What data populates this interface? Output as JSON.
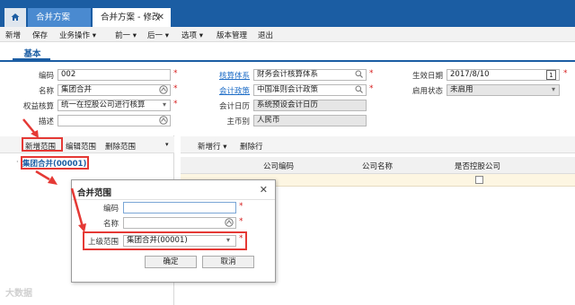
{
  "tabs": {
    "home_icon": "home-icon",
    "inactive_label": "合并方案",
    "active_label": "合并方案 - 修改",
    "close_glyph": "✕"
  },
  "menu": {
    "new": "新增",
    "save": "保存",
    "business_ops": "业务操作",
    "prev": "前一",
    "next": "后一",
    "options": "选项",
    "version_mgmt": "版本管理",
    "exit": "退出",
    "dropdown_glyph": "▾"
  },
  "section": {
    "basic": "基本"
  },
  "form": {
    "code_label": "编码",
    "code_value": "002",
    "name_label": "名称",
    "name_value": "集团合并",
    "equity_label": "权益核算",
    "equity_value": "统一在控股公司进行核算",
    "desc_label": "描述",
    "desc_value": "",
    "acct_system_label": "核算体系",
    "acct_system_value": "财务会计核算体系",
    "acct_policy_label": "会计政策",
    "acct_policy_value": "中国准则会计政策",
    "acct_calendar_label": "会计日历",
    "acct_calendar_value": "系统预设会计日历",
    "currency_label": "主币别",
    "currency_value": "人民币",
    "eff_date_label": "生效日期",
    "eff_date_value": "2017/8/10",
    "status_label": "启用状态",
    "status_value": "未启用",
    "calendar_day": "1",
    "required_mark": "*"
  },
  "left_toolbar": {
    "add_scope": "新增范围",
    "edit_scope": "编辑范围",
    "delete_scope": "删除范围"
  },
  "tree": {
    "root": "集团合并(00001)",
    "bullet": "·"
  },
  "right_toolbar": {
    "add_row": "新增行",
    "delete_row": "删除行"
  },
  "grid": {
    "col_code": "公司编码",
    "col_name": "公司名称",
    "col_controlled": "是否控股公司"
  },
  "dialog": {
    "title": "合并范围",
    "close_glyph": "✕",
    "code_label": "编码",
    "code_value": "",
    "name_label": "名称",
    "name_value": "",
    "parent_label": "上级范围",
    "parent_value": "集团合并(00001)",
    "ok": "确定",
    "cancel": "取消"
  },
  "colors": {
    "header_blue": "#1b5da3",
    "link_blue": "#1b6bc6",
    "annotation_red": "#e53935",
    "row_highlight": "#fdf6e2"
  },
  "watermark": "大数据"
}
